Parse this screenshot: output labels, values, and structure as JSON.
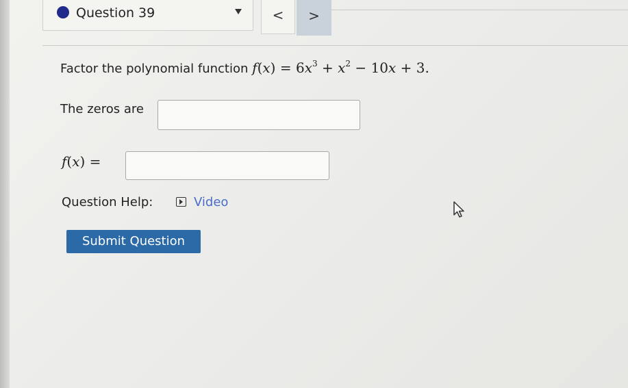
{
  "header": {
    "question_title": "Question 39",
    "prev_label": "<",
    "next_label": ">"
  },
  "problem": {
    "prompt_text": "Factor the polynomial function",
    "function_name": "f",
    "function_var": "x",
    "equals": "=",
    "term1_coef": "6",
    "term1_var": "x",
    "term1_exp": "3",
    "term2_var": "x",
    "term2_exp": "2",
    "term3": "10",
    "term3_var": "x",
    "term4": "3",
    "end_period": "."
  },
  "answers": {
    "zeros_label": "The zeros are",
    "zeros_value": "",
    "fx_name": "f",
    "fx_var": "x",
    "fx_equals": "=",
    "fx_value": ""
  },
  "help": {
    "label": "Question Help:",
    "video_label": "Video"
  },
  "submit": {
    "label": "Submit Question"
  },
  "icons": {
    "status": "status-dot-icon",
    "dropdown": "chevron-down-icon",
    "video": "video-icon",
    "cursor": "mouse-pointer-icon"
  },
  "colors": {
    "status_dot": "#1f2a8a",
    "submit_bg": "#2b6aa6",
    "link": "#4a6cc9",
    "next_bg": "#c9d1da"
  }
}
